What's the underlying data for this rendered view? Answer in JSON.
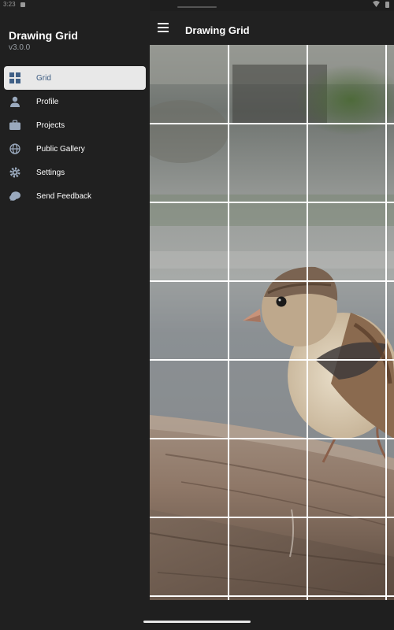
{
  "status": {
    "time": "3:23"
  },
  "drawer": {
    "title": "Drawing Grid",
    "version": "v3.0.0",
    "items": [
      {
        "label": "Grid",
        "icon": "grid-icon",
        "active": true
      },
      {
        "label": "Profile",
        "icon": "person-icon",
        "active": false
      },
      {
        "label": "Projects",
        "icon": "briefcase-icon",
        "active": false
      },
      {
        "label": "Public Gallery",
        "icon": "globe-icon",
        "active": false
      },
      {
        "label": "Settings",
        "icon": "gear-icon",
        "active": false
      },
      {
        "label": "Send Feedback",
        "icon": "feedback-icon",
        "active": false
      }
    ]
  },
  "appbar": {
    "title": "Drawing Grid",
    "menu_icon": "menu-icon"
  },
  "canvas": {
    "grid_columns": 4,
    "grid_rows": 7,
    "grid_color": "#ffffff",
    "image_subject": "sparrow-on-branch"
  },
  "colors": {
    "drawer_bg": "#202020",
    "active_item_bg": "#e8e8e8",
    "active_item_text": "#3a5a80"
  }
}
